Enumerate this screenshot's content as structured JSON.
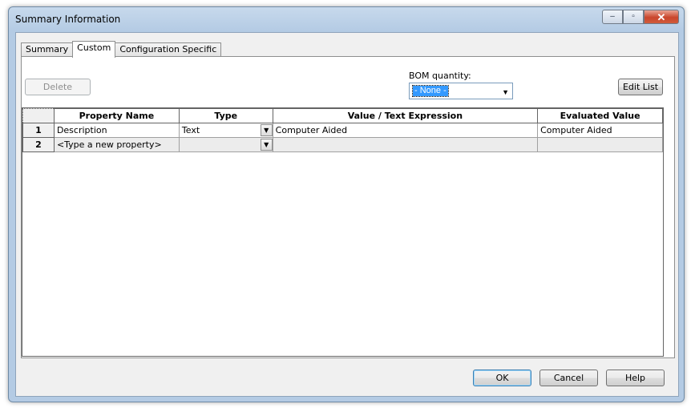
{
  "window": {
    "title": "Summary Information"
  },
  "title_buttons": {
    "minimize": "–",
    "maximize": "▫",
    "close": "✕"
  },
  "tabs": [
    {
      "label": "Summary"
    },
    {
      "label": "Custom"
    },
    {
      "label": "Configuration Specific"
    }
  ],
  "toolbar": {
    "delete_label": "Delete",
    "bom_label": "BOM quantity:",
    "bom_value": "- None -",
    "edit_list_label": "Edit List"
  },
  "grid": {
    "columns": [
      "Property Name",
      "Type",
      "Value / Text Expression",
      "Evaluated Value"
    ],
    "rows": [
      {
        "num": "1",
        "name": "Description",
        "type": "Text",
        "value": "Computer Aided",
        "evaluated": "Computer Aided"
      },
      {
        "num": "2",
        "name": "<Type a new property>",
        "type": "",
        "value": "",
        "evaluated": ""
      }
    ]
  },
  "footer": {
    "ok_label": "OK",
    "cancel_label": "Cancel",
    "help_label": "Help"
  }
}
